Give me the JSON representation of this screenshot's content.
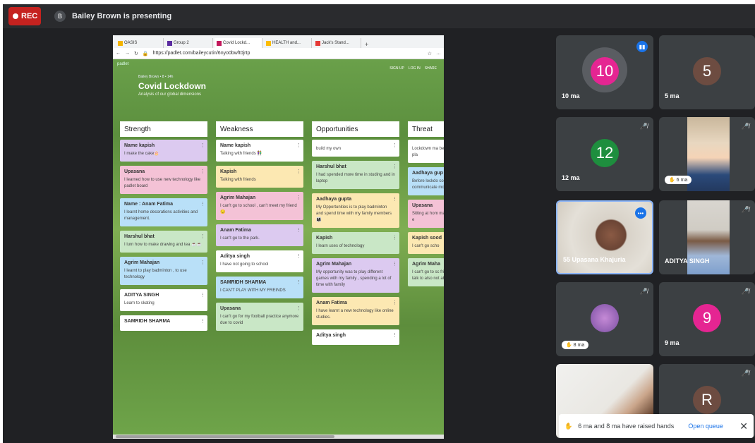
{
  "meeting": {
    "rec": "REC",
    "presenter_initial": "B",
    "presenting_text": "Bailey Brown is presenting"
  },
  "browser": {
    "tabs": [
      "OASIS",
      "Group 2",
      "Covid Lockd...",
      "HEALTH and...",
      "Jack's Stand..."
    ],
    "url": "https://padlet.com/baileycutin/6nyo0bwft0jrtp"
  },
  "padlet": {
    "logo": "padlet",
    "author": "Bailey Brown  •  8  •  14h",
    "title": "Covid Lockdown",
    "subtitle": "Analysis of our global dimensions",
    "menu": [
      "SIGN UP",
      "LOG IN",
      "SHARE"
    ],
    "columns": [
      {
        "header": "Strength",
        "cards": [
          {
            "t": "Name kapish",
            "b": "I make the cake🎂",
            "c": "lav"
          },
          {
            "t": "Upasana",
            "b": "I learned how to use new technology like padlet board",
            "c": "pink"
          },
          {
            "t": "Name : Anam Fatima",
            "b": "I learnt home decorations activities and management.",
            "c": "blue"
          },
          {
            "t": "Harshul bhat",
            "b": "I lurn how to make drawing and tea ☕☕",
            "c": "green"
          },
          {
            "t": "Agrim Mahajan",
            "b": "I learnt to play badminton , to use technology",
            "c": "blue"
          },
          {
            "t": "ADITYA SINGH",
            "b": "Learn to skating",
            "c": "white"
          },
          {
            "t": "SAMRIDH SHARMA",
            "b": "",
            "c": "white"
          }
        ]
      },
      {
        "header": "Weakness",
        "cards": [
          {
            "t": "Name kapish",
            "b": "Talking with friends 👫",
            "c": "white"
          },
          {
            "t": "Kapish",
            "b": "Talking with friends",
            "c": "yellow"
          },
          {
            "t": "Agrim Mahajan",
            "b": "I can't go to school , can't meet my friend 😔",
            "c": "pink"
          },
          {
            "t": "Anam Fatima",
            "b": "I can't go to the park.",
            "c": "lav"
          },
          {
            "t": "Aditya singh",
            "b": "I have not going to school",
            "c": "white"
          },
          {
            "t": "SAMRIDH SHARMA",
            "b": "I CAN'T PLAY WITH MY FREINDS",
            "c": "blue"
          },
          {
            "t": "Upasana",
            "b": "I can't go for my football practice anymore due to covid",
            "c": "green"
          }
        ]
      },
      {
        "header": "Opportunities",
        "cards": [
          {
            "t": "",
            "b": "build my own",
            "c": "white"
          },
          {
            "t": "Harshul bhat",
            "b": "I had spended more time in studing and in laptop",
            "c": "green"
          },
          {
            "t": "Aadhaya gupta",
            "b": "My Opportunities is to play badminton and spend time with my family members 👨‍👩‍👧",
            "c": "yellow"
          },
          {
            "t": "Kapish",
            "b": "I learn uses of technology",
            "c": "green"
          },
          {
            "t": "Agrim Mahajan",
            "b": "My opportunity was to play different games with my family , spending a lot of time with family",
            "c": "lav"
          },
          {
            "t": "Anam Fatima",
            "b": "I have learnt a new technology like online studies.",
            "c": "yellow"
          },
          {
            "t": "Aditya singh",
            "b": "",
            "c": "white"
          }
        ]
      },
      {
        "header": "Threat",
        "cards": [
          {
            "t": "",
            "b": "Lockdown ma before lockdo school and pla",
            "c": "white"
          },
          {
            "t": "Aadhaya gup",
            "b": "Before lockdo communicate friends 👫 Aft communicate mobile phone",
            "c": "blue"
          },
          {
            "t": "Upasana",
            "b": "Sitting at hom made less exp life teaching e",
            "c": "pink"
          },
          {
            "t": "Kapish sood",
            "b": "I can't go scho",
            "c": "yellow"
          },
          {
            "t": "Agrim Maha",
            "b": "I can't go to sc friend , teache Couldn't talk to also not able t",
            "c": "green"
          }
        ]
      }
    ]
  },
  "participants": [
    {
      "id": "10ma",
      "avatar": "10",
      "name": "10 ma",
      "color": "#e52592"
    },
    {
      "id": "5ma",
      "avatar": "5",
      "name": "5 ma",
      "color": "#6d4c41"
    },
    {
      "id": "12ma",
      "avatar": "12",
      "name": "12 ma",
      "color": "#1e8e3e"
    },
    {
      "id": "6ma",
      "name": "6 ma"
    },
    {
      "id": "upasana",
      "name": "55 Upasana Khajuria"
    },
    {
      "id": "aditya",
      "name": "ADITYA SINGH"
    },
    {
      "id": "8ma",
      "name": "8 ma"
    },
    {
      "id": "9ma",
      "avatar": "9",
      "name": "9 ma",
      "color": "#e52592"
    },
    {
      "id": "video7",
      "name": ""
    },
    {
      "id": "r",
      "avatar": "R",
      "name": "",
      "color": "#6d4c41"
    }
  ],
  "toast": {
    "text": "6 ma and 8 ma have raised hands",
    "action": "Open queue"
  }
}
